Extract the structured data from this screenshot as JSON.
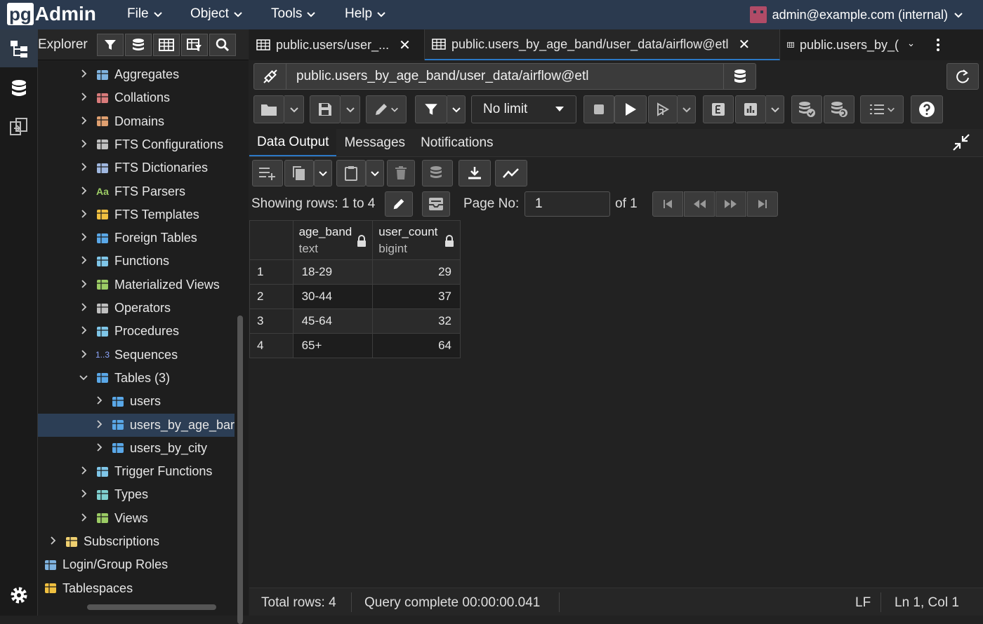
{
  "app": {
    "logo_pg": "pg",
    "logo_admin": "Admin"
  },
  "menu": {
    "items": [
      {
        "label": "File"
      },
      {
        "label": "Object"
      },
      {
        "label": "Tools"
      },
      {
        "label": "Help"
      }
    ],
    "user": "admin@example.com (internal)"
  },
  "explorer": {
    "title": "Explorer",
    "tree": [
      {
        "label": "Aggregates",
        "expanded": false
      },
      {
        "label": "Collations",
        "expanded": false
      },
      {
        "label": "Domains",
        "expanded": false
      },
      {
        "label": "FTS Configurations",
        "expanded": false
      },
      {
        "label": "FTS Dictionaries",
        "expanded": false
      },
      {
        "label": "FTS Parsers",
        "expanded": false
      },
      {
        "label": "FTS Templates",
        "expanded": false
      },
      {
        "label": "Foreign Tables",
        "expanded": false
      },
      {
        "label": "Functions",
        "expanded": false
      },
      {
        "label": "Materialized Views",
        "expanded": false
      },
      {
        "label": "Operators",
        "expanded": false
      },
      {
        "label": "Procedures",
        "expanded": false
      },
      {
        "label": "Sequences",
        "expanded": false
      },
      {
        "label": "Tables (3)",
        "expanded": true
      },
      {
        "label": "users",
        "expanded": false
      },
      {
        "label": "users_by_age_bar",
        "expanded": false,
        "selected": true
      },
      {
        "label": "users_by_city",
        "expanded": false
      },
      {
        "label": "Trigger Functions",
        "expanded": false
      },
      {
        "label": "Types",
        "expanded": false
      },
      {
        "label": "Views",
        "expanded": false
      },
      {
        "label": "Subscriptions",
        "expanded": false
      },
      {
        "label": "Login/Group Roles"
      },
      {
        "label": "Tablespaces"
      }
    ]
  },
  "tabs": [
    {
      "label": "public.users/user_...",
      "active": false
    },
    {
      "label": "public.users_by_age_band/user_data/airflow@etl",
      "active": true
    },
    {
      "label": "public.users_by_(",
      "active": false
    }
  ],
  "query": {
    "path": "public.users_by_age_band/user_data/airflow@etl",
    "limit": "No limit"
  },
  "results": {
    "tabs": [
      "Data Output",
      "Messages",
      "Notifications"
    ],
    "showing": "Showing rows: 1 to 4",
    "page_label": "Page No:",
    "page_no": "1",
    "page_of": "of 1",
    "columns": [
      {
        "name": "age_band",
        "type": "text"
      },
      {
        "name": "user_count",
        "type": "bigint"
      }
    ],
    "rows": [
      {
        "n": "1",
        "age_band": "18-29",
        "user_count": "29"
      },
      {
        "n": "2",
        "age_band": "30-44",
        "user_count": "37"
      },
      {
        "n": "3",
        "age_band": "45-64",
        "user_count": "32"
      },
      {
        "n": "4",
        "age_band": "65+",
        "user_count": "64"
      }
    ]
  },
  "status": {
    "total_rows": "Total rows: 4",
    "query_complete": "Query complete 00:00:00.041",
    "eol": "LF",
    "cursor": "Ln 1, Col 1"
  },
  "colors": {
    "menubar": "#2b3a4f",
    "accent": "#2b78c5",
    "selected": "#2c3e55"
  }
}
